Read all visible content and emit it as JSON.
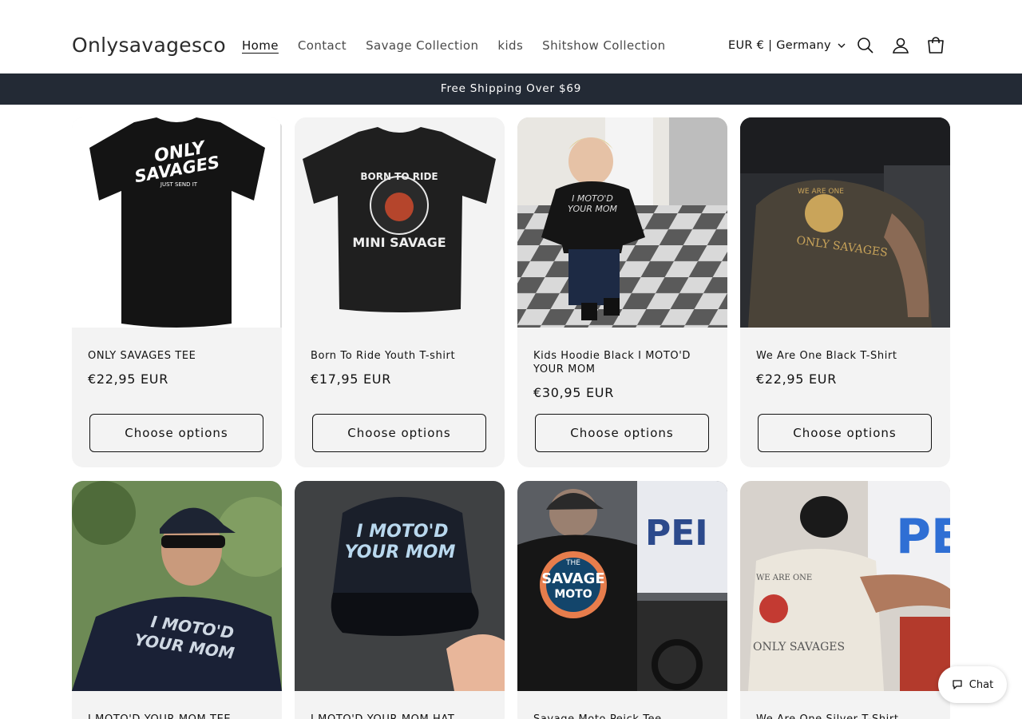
{
  "header": {
    "logo": "Onlysavagesco",
    "nav": [
      "Home",
      "Contact",
      "Savage Collection",
      "kids",
      "Shitshow Collection"
    ],
    "locale": "EUR € | Germany",
    "icons": [
      "search-icon",
      "account-icon",
      "cart-icon"
    ]
  },
  "announcement": "Free Shipping Over $69",
  "products": [
    {
      "title": "ONLY SAVAGES TEE",
      "price": "€22,95 EUR",
      "button": "Choose options"
    },
    {
      "title": "Born To Ride Youth T-shirt",
      "price": "€17,95 EUR",
      "button": "Choose options"
    },
    {
      "title": "Kids Hoodie Black I MOTO'D YOUR MOM",
      "price": "€30,95 EUR",
      "button": "Choose options"
    },
    {
      "title": "We Are One Black T-Shirt",
      "price": "€22,95 EUR",
      "button": "Choose options"
    },
    {
      "title": "I MOTO'D YOUR MOM TEE",
      "price": "",
      "button": ""
    },
    {
      "title": "I MOTO'D YOUR MOM HAT",
      "price": "",
      "button": ""
    },
    {
      "title": "Savage Moto Peick Tee",
      "price": "",
      "button": ""
    },
    {
      "title": "We Are One Silver T-Shirt",
      "price": "",
      "button": ""
    }
  ],
  "product_art": [
    {
      "line1": "ONLY",
      "line2": "SAVAGES",
      "line3": "JUST SEND IT"
    },
    {
      "line1": "BORN TO RIDE",
      "line2": "MINI SAVAGE"
    },
    {
      "line1": "I MOTO'D",
      "line2": "YOUR MOM"
    },
    {
      "line1": "WE ARE ONE",
      "line2": "ONLY SAVAGES"
    },
    {
      "line1": "I MOTO'D",
      "line2": "YOUR MOM"
    },
    {
      "line1": "I MOTO'D",
      "line2": "YOUR MOM"
    },
    {
      "line1": "THE",
      "line2": "SAVAGE",
      "line3": "MOTO"
    },
    {
      "line1": "WE ARE ONE",
      "line2": "ONLY SAVAGES"
    }
  ],
  "chat": {
    "label": "Chat"
  }
}
